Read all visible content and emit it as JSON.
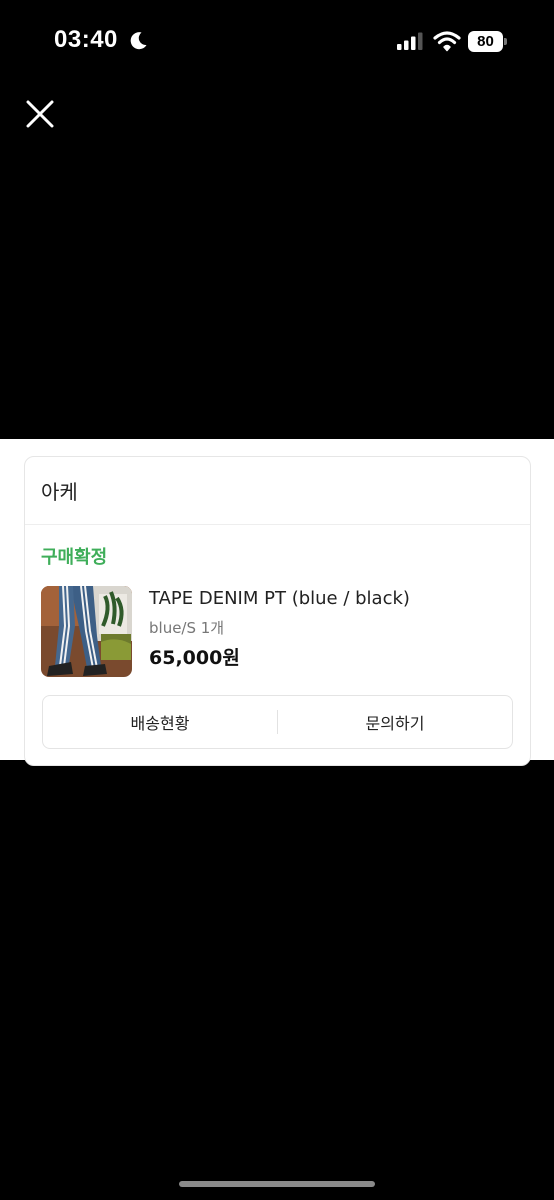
{
  "status_bar": {
    "time": "03:40",
    "battery_level": "80",
    "icons": [
      "moon-icon",
      "signal-icon",
      "wifi-icon",
      "battery-icon"
    ]
  },
  "close_icon": "close-icon",
  "order": {
    "store_name": "아케",
    "status": "구매확정",
    "status_color": "#3fae5a",
    "product": {
      "name": "TAPE DENIM PT (blue / black)",
      "option": "blue/S 1개",
      "price": "65,000원"
    },
    "actions": {
      "tracking_label": "배송현황",
      "inquiry_label": "문의하기"
    }
  }
}
